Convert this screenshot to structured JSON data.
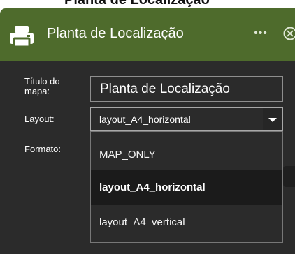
{
  "top_cut_title": "Planta de Localização",
  "panel": {
    "title": "Planta de Localização",
    "icons": {
      "printer": "printer-icon",
      "more": "more-icon",
      "close": "close-icon"
    },
    "more_label": "•••"
  },
  "form": {
    "title_label": "Título do mapa:",
    "title_value": "Planta de Localização",
    "layout_label": "Layout:",
    "layout_value": "layout_A4_horizontal",
    "format_label": "Formato:"
  },
  "dropdown": {
    "options": [
      "MAP_ONLY",
      "layout_A4_horizontal",
      "layout_A4_vertical"
    ],
    "selected": "layout_A4_horizontal"
  },
  "colors": {
    "header": "#4e6b2c",
    "body": "#2b2b2b",
    "selected_option": "#1b1b1b",
    "text": "#ffffff"
  }
}
